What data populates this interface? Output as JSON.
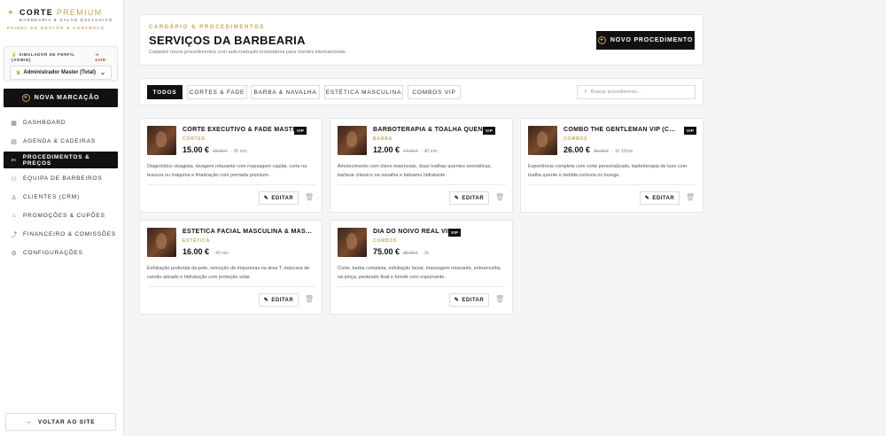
{
  "brand": {
    "name": "CORTE",
    "name_accent": "PREMIUM",
    "subtitle": "BARBEARIA & SALÃO EXCLUSIVO",
    "panel": "PAINEL DE GESTÃO & CONTROLO"
  },
  "simulator": {
    "label": "SIMULADOR DE PERFIL (ADMIN)",
    "exit": "SAIR",
    "selected": "Administrador Master (Total)"
  },
  "sidebar": {
    "new_booking": "NOVA MARCAÇÃO",
    "items": [
      {
        "label": "DASHBOARD",
        "icon": "grid-icon",
        "active": false
      },
      {
        "label": "AGENDA & CADEIRAS",
        "icon": "calendar-icon",
        "active": false
      },
      {
        "label": "PROCEDIMENTOS & PREÇOS",
        "icon": "scissors-icon",
        "active": true
      },
      {
        "label": "EQUIPA DE BARBEIROS",
        "icon": "team-icon",
        "active": false
      },
      {
        "label": "CLIENTES (CRM)",
        "icon": "user-icon",
        "active": false
      },
      {
        "label": "PROMOÇÕES & CUPÕES",
        "icon": "tag-icon",
        "active": false
      },
      {
        "label": "FINANCEIRO & COMISSÕES",
        "icon": "trend-icon",
        "active": false
      },
      {
        "label": "CONFIGURAÇÕES",
        "icon": "gear-icon",
        "active": false
      }
    ],
    "back_site": "VOLTAR AO SITE"
  },
  "header": {
    "eyebrow": "CARDÁPIO & PROCEDIMENTOS",
    "title": "SERVIÇOS DA BARBEARIA",
    "description": "Cadastre novos procedimentos com auto-tradução instantânea para clientes internacionais.",
    "new_button": "NOVO PROCEDIMENTO"
  },
  "filters": {
    "tabs": [
      "TODOS",
      "CORTES & FADE",
      "BARBA & NAVALHA",
      "ESTÉTICA MASCULINA",
      "COMBOS VIP"
    ],
    "search_placeholder": "Buscar procedimento..."
  },
  "services": [
    {
      "title": "CORTE EXECUTIVO & FADE MASTER",
      "vip": "VIP",
      "category": "CORTES",
      "price": "15.00 €",
      "old_price": "18.00 €",
      "duration": "· 45 min",
      "description": "Diagnóstico visagista, lavagem relaxante com massagem capilar, corte na tesoura ou máquina e finalização com pomada premium.",
      "edit": "EDITAR"
    },
    {
      "title": "BARBOTERAPIA & TOALHA QUENTE",
      "vip": "VIP",
      "category": "BARBA",
      "price": "12.00 €",
      "old_price": "14.00 €",
      "duration": "· 40 min",
      "description": "Amolecimento com óleos essenciais, duas toalhas quentes aromáticas, barbear clássico na navalha e bálsamo hidratante.",
      "edit": "EDITAR"
    },
    {
      "title": "COMBO THE GENTLEMAN VIP (CABELO + BARBA)",
      "vip": "VIP",
      "category": "COMBOS",
      "price": "26.00 €",
      "old_price": "30.00 €",
      "duration": "· 1h 15min",
      "description": "Experiência completa com corte personalizado, barboterapia de luxo com toalha quente e bebida cortesia no lounge.",
      "edit": "EDITAR"
    },
    {
      "title": "ESTÉTICA FACIAL MASCULINA & MÁSCARA",
      "vip": "",
      "category": "ESTÉTICA",
      "price": "16.00 €",
      "old_price": "",
      "duration": "· 40 min",
      "description": "Esfoliação profunda da pele, remoção de impurezas na área T, máscara de carvão ativado e hidratação com proteção solar.",
      "edit": "EDITAR"
    },
    {
      "title": "DIA DO NOIVO REAL VIP",
      "vip": "VIP",
      "category": "COMBOS",
      "price": "75.00 €",
      "old_price": "85.00 €",
      "duration": "· 2h",
      "description": "Corte, barba completa, esfoliação facial, massagem relaxante, sobrancelha na pinça, penteado final e brinde com espumante.",
      "edit": "EDITAR"
    }
  ],
  "colors": {
    "accent": "#c9a45c",
    "dark": "#111111"
  }
}
